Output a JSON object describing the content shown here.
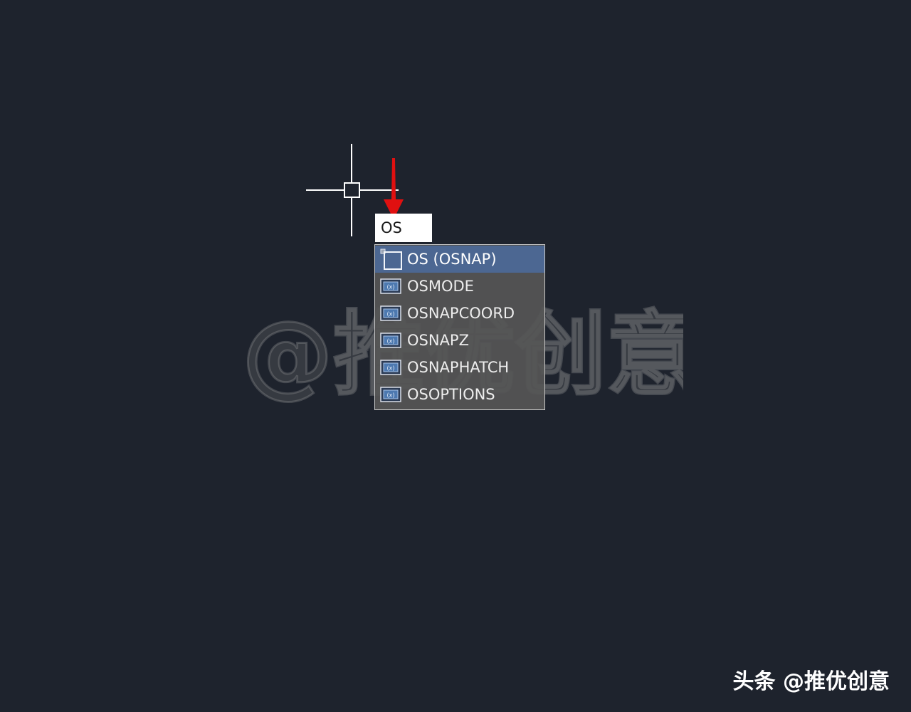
{
  "command_line": {
    "input_value": "OS"
  },
  "autocomplete": {
    "items": [
      {
        "label": "OS (OSNAP)",
        "icon": "osnap-command-icon",
        "selected": true
      },
      {
        "label": "OSMODE",
        "icon": "system-variable-icon",
        "selected": false
      },
      {
        "label": "OSNAPCOORD",
        "icon": "system-variable-icon",
        "selected": false
      },
      {
        "label": "OSNAPZ",
        "icon": "system-variable-icon",
        "selected": false
      },
      {
        "label": "OSNAPHATCH",
        "icon": "system-variable-icon",
        "selected": false
      },
      {
        "label": "OSOPTIONS",
        "icon": "system-variable-icon",
        "selected": false
      }
    ]
  },
  "watermark": {
    "center_text": "@推优创意",
    "source_credit": "头条 @推优创意"
  },
  "colors": {
    "canvas_background": "#1e232d",
    "selected_item": "#4c6792",
    "list_background": "#565656",
    "annotation_arrow": "#e01010"
  }
}
